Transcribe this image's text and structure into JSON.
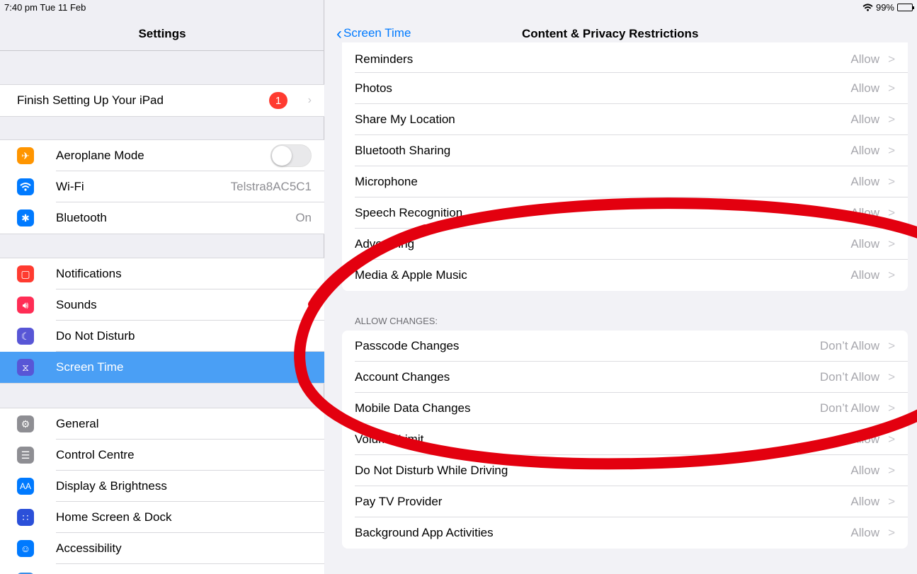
{
  "status_bar": {
    "time": "7:40 pm  Tue 11 Feb",
    "battery": "99%"
  },
  "left": {
    "title": "Settings",
    "finish_setup": {
      "label": "Finish Setting Up Your iPad",
      "badge": "1"
    },
    "group1": [
      {
        "label": "Aeroplane Mode",
        "icon": "airplane-icon",
        "color": "#ff9500",
        "value": ""
      },
      {
        "label": "Wi-Fi",
        "icon": "wifi-icon",
        "color": "#007aff",
        "value": "Telstra8AC5C1"
      },
      {
        "label": "Bluetooth",
        "icon": "bluetooth-icon",
        "color": "#007aff",
        "value": "On"
      }
    ],
    "group2": [
      {
        "label": "Notifications",
        "icon": "notifications-icon",
        "color": "#ff3b30"
      },
      {
        "label": "Sounds",
        "icon": "sounds-icon",
        "color": "#ff2d55"
      },
      {
        "label": "Do Not Disturb",
        "icon": "moon-icon",
        "color": "#5856d6"
      },
      {
        "label": "Screen Time",
        "icon": "hourglass-icon",
        "color": "#5856d6"
      }
    ],
    "group3": [
      {
        "label": "General",
        "icon": "gear-icon",
        "color": "#8e8e93"
      },
      {
        "label": "Control Centre",
        "icon": "switches-icon",
        "color": "#8e8e93"
      },
      {
        "label": "Display & Brightness",
        "icon": "aa-icon",
        "color": "#007aff"
      },
      {
        "label": "Home Screen & Dock",
        "icon": "grid-icon",
        "color": "#2b50d9"
      },
      {
        "label": "Accessibility",
        "icon": "accessibility-icon",
        "color": "#007aff"
      }
    ]
  },
  "right": {
    "back_label": "Screen Time",
    "title": "Content & Privacy Restrictions",
    "privacy_rows": [
      {
        "label": "Reminders",
        "value": "Allow"
      },
      {
        "label": "Photos",
        "value": "Allow"
      },
      {
        "label": "Share My Location",
        "value": "Allow"
      },
      {
        "label": "Bluetooth Sharing",
        "value": "Allow"
      },
      {
        "label": "Microphone",
        "value": "Allow"
      },
      {
        "label": "Speech Recognition",
        "value": "Allow"
      },
      {
        "label": "Advertising",
        "value": "Allow"
      },
      {
        "label": "Media & Apple Music",
        "value": "Allow"
      }
    ],
    "section_header": "ALLOW CHANGES:",
    "change_rows": [
      {
        "label": "Passcode Changes",
        "value": "Don’t Allow"
      },
      {
        "label": "Account Changes",
        "value": "Don’t Allow"
      },
      {
        "label": "Mobile Data Changes",
        "value": "Don’t Allow"
      },
      {
        "label": "Volume Limit",
        "value": "Allow"
      },
      {
        "label": "Do Not Disturb While Driving",
        "value": "Allow"
      },
      {
        "label": "Pay TV Provider",
        "value": "Allow"
      },
      {
        "label": "Background App Activities",
        "value": "Allow"
      }
    ]
  },
  "annotation_color": "#e3000f"
}
